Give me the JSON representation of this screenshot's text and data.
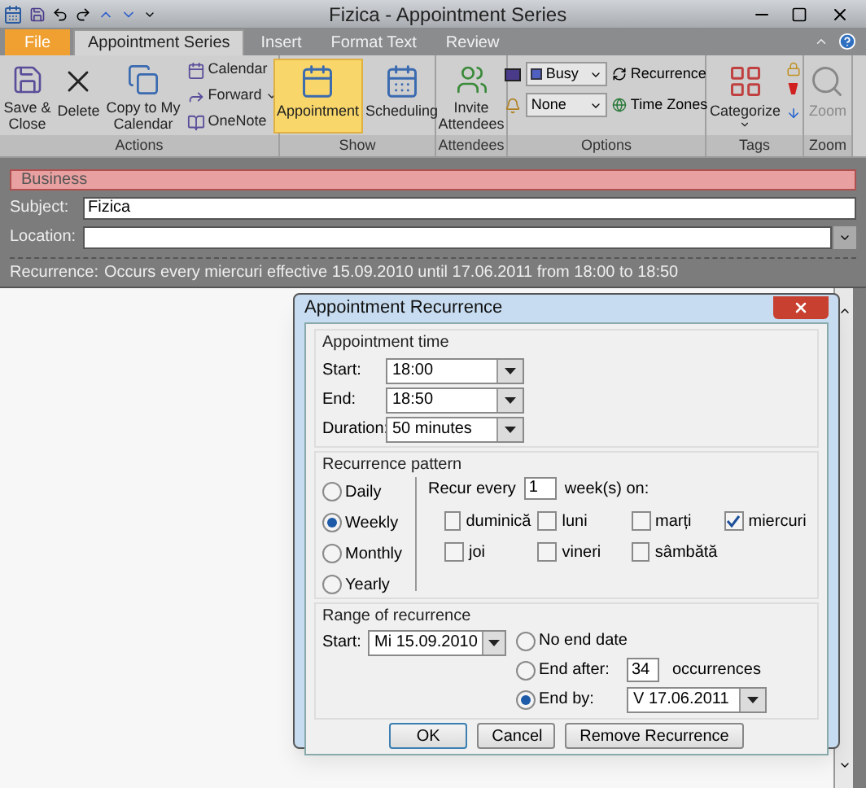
{
  "window": {
    "title": "Fizica - Appointment Series"
  },
  "tabs": [
    {
      "label": "File",
      "selected": false,
      "kind": "file"
    },
    {
      "label": "Appointment Series",
      "selected": true,
      "kind": "tab"
    },
    {
      "label": "Insert",
      "selected": false,
      "kind": "tab"
    },
    {
      "label": "Format Text",
      "selected": false,
      "kind": "tab"
    },
    {
      "label": "Review",
      "selected": false,
      "kind": "tab"
    }
  ],
  "ribbon": {
    "groups": [
      {
        "label": "Actions",
        "items": [
          {
            "kind": "large",
            "label": "Save &\nClose"
          },
          {
            "kind": "large",
            "label": "Delete"
          },
          {
            "kind": "large",
            "label": "Copy to My\nCalendar"
          },
          {
            "kind": "smallstack",
            "items": [
              {
                "label": "Calendar",
                "menu": false
              },
              {
                "label": "Forward",
                "menu": true
              },
              {
                "label": "OneNote",
                "menu": false
              }
            ]
          }
        ]
      },
      {
        "label": "Show",
        "items": [
          {
            "kind": "large",
            "label": "Appointment",
            "selected": true
          },
          {
            "kind": "large",
            "label": "Scheduling",
            "selected": false
          }
        ]
      },
      {
        "label": "Attendees",
        "items": [
          {
            "kind": "large",
            "label": "Invite\nAttendees"
          }
        ]
      },
      {
        "label": "Options",
        "items": [
          {
            "kind": "options",
            "combos": [
              "Busy",
              "None"
            ],
            "actions": [
              "Recurrence",
              "Time Zones"
            ]
          }
        ]
      },
      {
        "label": "Tags",
        "items": [
          {
            "kind": "large",
            "label": "Categorize",
            "menu": true
          },
          {
            "kind": "tagicons"
          }
        ]
      },
      {
        "label": "Zoom",
        "items": [
          {
            "kind": "large",
            "label": "Zoom",
            "disabled": true
          }
        ]
      }
    ]
  },
  "form": {
    "category": {
      "label": "Business",
      "color": "#e8a0a0"
    },
    "subject": {
      "label": "Subject:",
      "value": "Fizica"
    },
    "location": {
      "label": "Location:"
    },
    "recurrence": {
      "label": "Recurrence:",
      "text": "Occurs every miercuri effective 15.09.2010 until 17.06.2011 from 18:00 to 18:50"
    }
  },
  "dialog": {
    "title": "Appointment Recurrence",
    "time": {
      "title": "Appointment time",
      "fields": [
        {
          "label": "Start:",
          "value": "18:00"
        },
        {
          "label": "End:",
          "value": "18:50"
        },
        {
          "label": "Duration:",
          "value": "50 minutes"
        }
      ]
    },
    "pattern": {
      "title": "Recurrence pattern",
      "options": [
        {
          "label": "Daily",
          "selected": false
        },
        {
          "label": "Weekly",
          "selected": true
        },
        {
          "label": "Monthly",
          "selected": false
        },
        {
          "label": "Yearly",
          "selected": false
        }
      ],
      "recur_label": "Recur every",
      "recur_value": "1",
      "recur_suffix": "week(s) on:",
      "days": [
        {
          "label": "duminică",
          "checked": false
        },
        {
          "label": "luni",
          "checked": false
        },
        {
          "label": "marți",
          "checked": false
        },
        {
          "label": "miercuri",
          "checked": true
        },
        {
          "label": "joi",
          "checked": false
        },
        {
          "label": "vineri",
          "checked": false
        },
        {
          "label": "sâmbătă",
          "checked": false
        }
      ]
    },
    "range": {
      "title": "Range of recurrence",
      "start_label": "Start:",
      "start_value": "Mi 15.09.2010",
      "options": [
        {
          "kind": "plain",
          "label": "No end date",
          "selected": false
        },
        {
          "kind": "count",
          "label": "End after:",
          "value": "34",
          "suffix": "occurrences",
          "selected": false
        },
        {
          "kind": "date",
          "label": "End by:",
          "value": "V 17.06.2011",
          "selected": true
        }
      ]
    },
    "buttons": [
      "OK",
      "Cancel",
      "Remove Recurrence"
    ]
  }
}
